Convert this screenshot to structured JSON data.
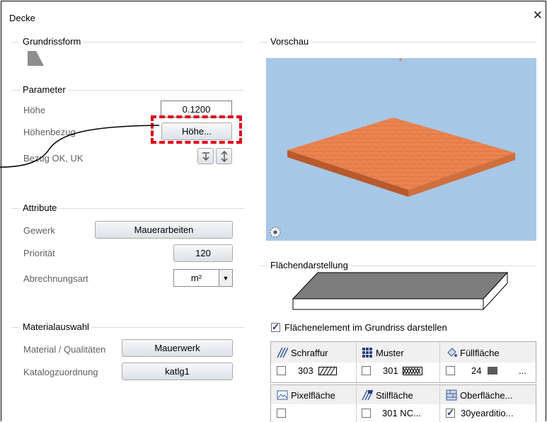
{
  "window": {
    "title": "Decke",
    "close_glyph": "✕"
  },
  "left": {
    "grundrissform": {
      "label": "Grundrissform"
    },
    "parameter": {
      "label": "Parameter",
      "hoehe_label": "Höhe",
      "hoehe_value": "0.1200",
      "hoehenbezug_label": "Höhenbezug",
      "hoehenbezug_button": "Höhe...",
      "bezug_label": "Bezug OK, UK"
    },
    "attribute": {
      "label": "Attribute",
      "gewerk_label": "Gewerk",
      "gewerk_value": "Mauerarbeiten",
      "prioritaet_label": "Priorität",
      "prioritaet_value": "120",
      "abrechnungsart_label": "Abrechnungsart",
      "abrechnungsart_value": "m²"
    },
    "materialauswahl": {
      "label": "Materialauswahl",
      "material_label": "Material / Qualitäten",
      "material_value": "Mauerwerk",
      "katalog_label": "Katalogzuordnung",
      "katalog_value": "katlg1"
    }
  },
  "right": {
    "vorschau": {
      "label": "Vorschau"
    },
    "flaechendarstellung": {
      "label": "Flächendarstellung",
      "checkbox_label": "Flächenelement im Grundriss darstellen",
      "checkbox_checked": true
    },
    "table": {
      "row1_headers": [
        "Schraffur",
        "Muster",
        "Füllfläche"
      ],
      "row1_values": [
        "303",
        "301",
        "24",
        "..."
      ],
      "row2_headers": [
        "Pixelfläche",
        "Stilfläche",
        "Oberfläche..."
      ],
      "row2_values": [
        "",
        "301 NC...",
        "30yearditio..."
      ]
    }
  },
  "colors": {
    "highlight": "#e0001b",
    "preview_bg": "#a7c7e7",
    "brick": "#e8804a"
  }
}
